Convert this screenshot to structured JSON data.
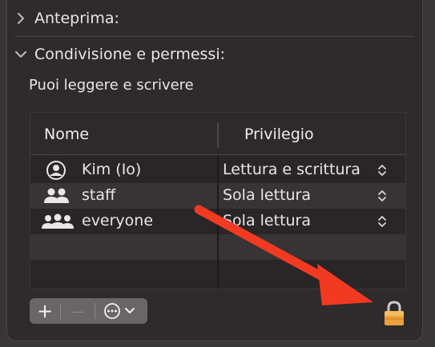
{
  "sections": {
    "preview_label": "Anteprima:",
    "sharing_label": "Condivisione e permessi:"
  },
  "permission_summary": "Puoi leggere e scrivere",
  "table": {
    "headers": {
      "name": "Nome",
      "privilege": "Privilegio"
    },
    "rows": [
      {
        "name": "Kim (Io)",
        "privilege": "Lettura e scrittura",
        "icon": "user-circle-icon"
      },
      {
        "name": "staff",
        "privilege": "Sola lettura",
        "icon": "group-icon"
      },
      {
        "name": "everyone",
        "privilege": "Sola lettura",
        "icon": "everyone-icon"
      }
    ]
  },
  "toolbar": {
    "add": "+",
    "remove": "—"
  },
  "colors": {
    "annotation_arrow": "#f23a22",
    "lock": "#e9a23b"
  }
}
